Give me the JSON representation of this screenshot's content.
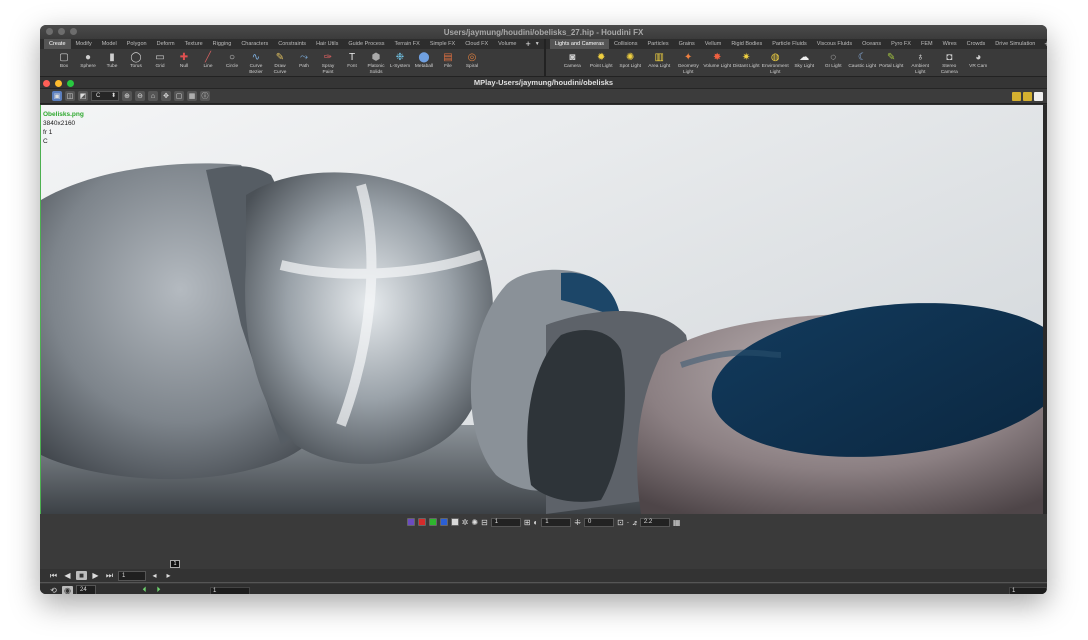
{
  "window": {
    "title": "Users/jaymung/houdini/obelisks_27.hip - Houdini FX"
  },
  "left_shelf": {
    "tabs": [
      "Create",
      "Modify",
      "Model",
      "Polygon",
      "Deform",
      "Texture",
      "Rigging",
      "Characters",
      "Constraints",
      "Hair Utils",
      "Guide Process",
      "Terrain FX",
      "Simple FX",
      "Cloud FX",
      "Volume"
    ],
    "active_tab": "Create",
    "tools": [
      {
        "label": "Box",
        "icon": "box-icon"
      },
      {
        "label": "Sphere",
        "icon": "sphere-icon"
      },
      {
        "label": "Tube",
        "icon": "tube-icon"
      },
      {
        "label": "Torus",
        "icon": "torus-icon"
      },
      {
        "label": "Grid",
        "icon": "grid-icon"
      },
      {
        "label": "Null",
        "icon": "null-icon"
      },
      {
        "label": "Line",
        "icon": "line-icon"
      },
      {
        "label": "Circle",
        "icon": "circle-icon"
      },
      {
        "label": "Curve Bezier",
        "icon": "curve-bezier-icon"
      },
      {
        "label": "Draw Curve",
        "icon": "draw-curve-icon"
      },
      {
        "label": "Path",
        "icon": "path-icon"
      },
      {
        "label": "Spray Paint",
        "icon": "spray-paint-icon"
      },
      {
        "label": "Font",
        "icon": "font-icon"
      },
      {
        "label": "Platonic Solids",
        "icon": "platonic-solids-icon"
      },
      {
        "label": "L-System",
        "icon": "l-system-icon"
      },
      {
        "label": "Metaball",
        "icon": "metaball-icon"
      },
      {
        "label": "File",
        "icon": "file-icon"
      },
      {
        "label": "Spiral",
        "icon": "spiral-icon"
      }
    ]
  },
  "right_shelf": {
    "tabs": [
      "Lights and Cameras",
      "Collisions",
      "Particles",
      "Grains",
      "Vellum",
      "Rigid Bodies",
      "Particle Fluids",
      "Viscous Fluids",
      "Oceans",
      "Pyro FX",
      "FEM",
      "Wires",
      "Crowds",
      "Drive Simulation"
    ],
    "active_tab": "Lights and Cameras",
    "tools": [
      {
        "label": "Camera",
        "icon": "camera-icon"
      },
      {
        "label": "Point Light",
        "icon": "point-light-icon"
      },
      {
        "label": "Spot Light",
        "icon": "spot-light-icon"
      },
      {
        "label": "Area Light",
        "icon": "area-light-icon"
      },
      {
        "label": "Geometry Light",
        "icon": "geometry-light-icon"
      },
      {
        "label": "Volume Light",
        "icon": "volume-light-icon"
      },
      {
        "label": "Distant Light",
        "icon": "distant-light-icon"
      },
      {
        "label": "Environment Light",
        "icon": "environment-light-icon"
      },
      {
        "label": "Sky Light",
        "icon": "sky-light-icon"
      },
      {
        "label": "GI Light",
        "icon": "gi-light-icon"
      },
      {
        "label": "Caustic Light",
        "icon": "caustic-light-icon"
      },
      {
        "label": "Portal Light",
        "icon": "portal-light-icon"
      },
      {
        "label": "Ambient Light",
        "icon": "ambient-light-icon"
      },
      {
        "label": "Stereo Camera",
        "icon": "stereo-camera-icon"
      },
      {
        "label": "VR Cam",
        "icon": "vr-camera-icon"
      }
    ]
  },
  "mplay": {
    "title": "MPlay-Users/jaymung/houdini/obelisks",
    "channel_select": "C",
    "overlay": {
      "filename": "Obelisks.png",
      "resolution": "3840x2160",
      "frame": "fr 1",
      "channel": "C"
    }
  },
  "display_bar": {
    "exposure_value": "1",
    "gamma_value": "1",
    "offset_value": "0",
    "lut_value": "2.2"
  },
  "playbar": {
    "current_frame": "1",
    "marker_frame": "1",
    "fps": "24",
    "range_start": "1",
    "range_end": "1"
  }
}
